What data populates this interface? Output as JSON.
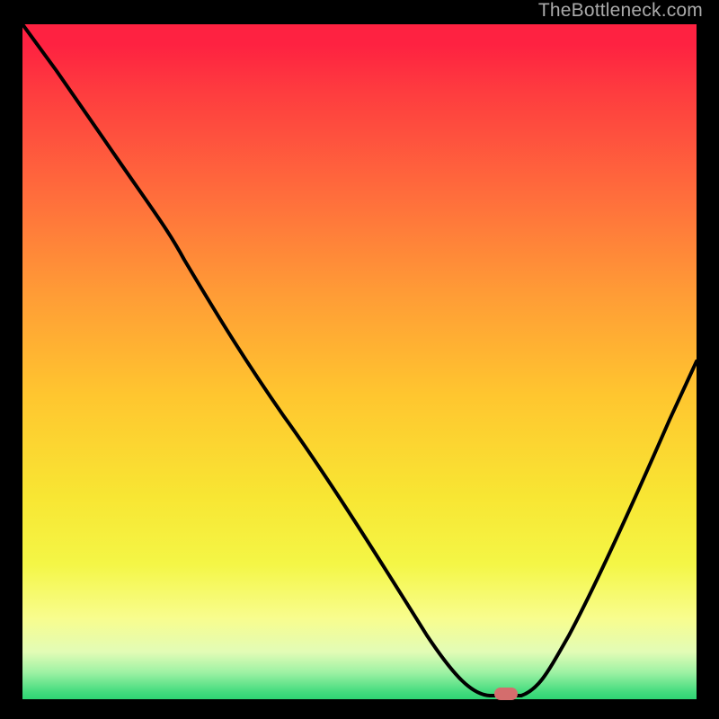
{
  "watermark": "TheBottleneck.com",
  "marker": {
    "color": "#d46d6d",
    "x_frac": 0.718,
    "y_frac": 0.995
  },
  "chart_data": {
    "type": "line",
    "title": "",
    "xlabel": "",
    "ylabel": "",
    "annotations": [
      "TheBottleneck.com"
    ],
    "legend": [],
    "gradient": {
      "direction": "vertical",
      "stops": [
        {
          "pos": 0.0,
          "color": "#fe2241"
        },
        {
          "pos": 0.25,
          "color": "#ff6c3c"
        },
        {
          "pos": 0.55,
          "color": "#ffc62f"
        },
        {
          "pos": 0.8,
          "color": "#f4f646"
        },
        {
          "pos": 0.93,
          "color": "#e2fcb6"
        },
        {
          "pos": 1.0,
          "color": "#2ed573"
        }
      ]
    },
    "xlim": [
      0,
      1
    ],
    "ylim": [
      0,
      1
    ],
    "series": [
      {
        "name": "curve",
        "x": [
          0.0,
          0.05,
          0.12,
          0.215,
          0.28,
          0.35,
          0.43,
          0.5,
          0.58,
          0.64,
          0.68,
          0.72,
          0.76,
          0.79,
          0.83,
          0.88,
          0.94,
          1.0
        ],
        "y": [
          1.0,
          0.93,
          0.83,
          0.7,
          0.64,
          0.555,
          0.45,
          0.35,
          0.23,
          0.14,
          0.06,
          0.005,
          0.005,
          0.04,
          0.11,
          0.22,
          0.35,
          0.49
        ]
      }
    ],
    "marker": {
      "x": 0.718,
      "y": 0.005
    }
  }
}
